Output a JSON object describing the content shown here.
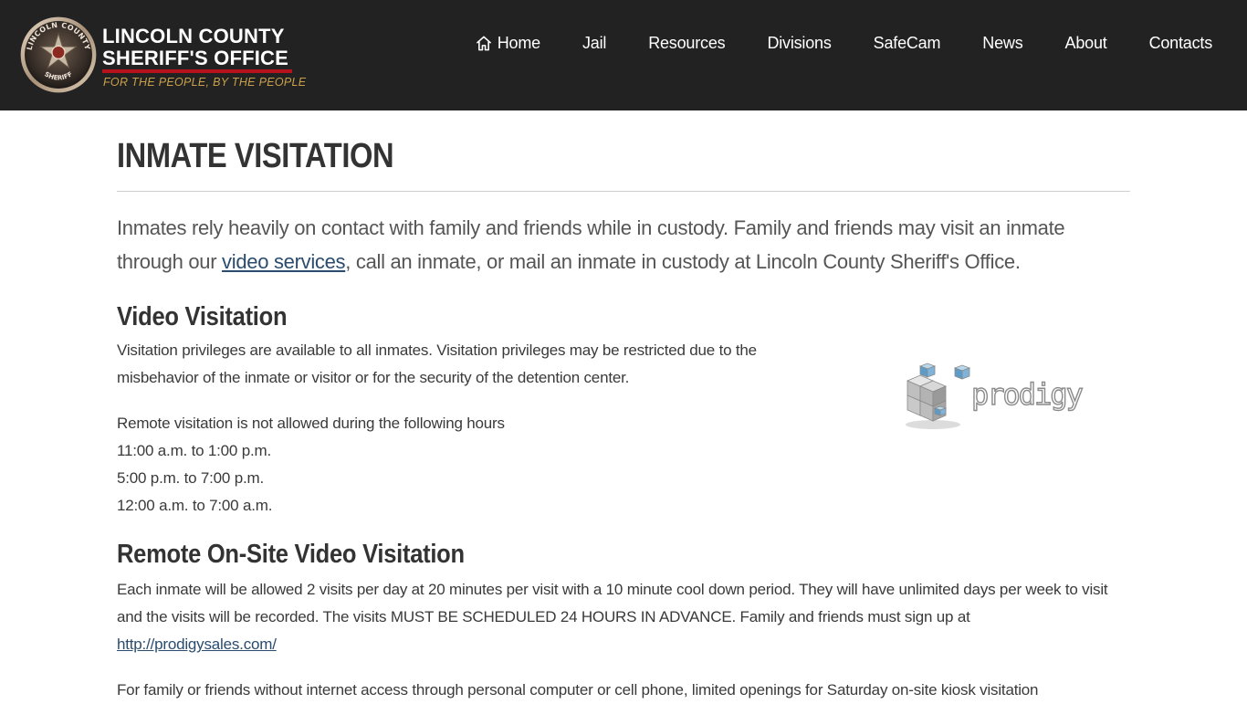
{
  "header": {
    "logo": {
      "line1": "LINCOLN COUNTY",
      "line2": "SHERIFF'S OFFICE",
      "tagline": "FOR THE PEOPLE, BY THE PEOPLE",
      "badge_top_text": "LINCOLN COUNTY",
      "badge_bottom_text": "SHERIFF"
    },
    "nav": [
      {
        "label": "Home",
        "icon": "home-icon"
      },
      {
        "label": "Jail"
      },
      {
        "label": "Resources"
      },
      {
        "label": "Divisions"
      },
      {
        "label": "SafeCam"
      },
      {
        "label": "News"
      },
      {
        "label": "About"
      },
      {
        "label": "Contacts"
      }
    ]
  },
  "page": {
    "title": "INMATE VISITATION",
    "intro": {
      "before_link": "Inmates rely heavily on contact with family and friends while in custody. Family and friends may visit an inmate through our ",
      "link": "video services",
      "after_link": ", call an inmate, or mail an inmate in custody at Lincoln County Sheriff's Office."
    },
    "video_visitation": {
      "heading": "Video Visitation",
      "paragraph": "Visitation privileges are available to all inmates. Visitation privileges may be restricted due to the misbehavior of the inmate or visitor or for the security of the detention center.",
      "hours_intro": "Remote visitation is not allowed during the following hours",
      "hours": [
        "11:00 a.m. to 1:00 p.m.",
        "5:00 p.m. to 7:00 p.m.",
        "12:00 a.m. to 7:00 a.m."
      ],
      "partner_logo_text": "prodigy"
    },
    "remote_onsite": {
      "heading": "Remote On-Site Video Visitation",
      "paragraph": "Each inmate will be allowed 2 visits per day at 20 minutes per visit with a 10 minute cool down period. They will have unlimited days per week to visit and the visits will be recorded. The visits MUST BE SCHEDULED 24 HOURS IN ADVANCE. Family and friends must sign up at",
      "link": "http://prodigysales.com/",
      "next_paragraph": "For family or friends without internet access through personal computer or cell phone, limited openings for Saturday on-site kiosk visitation"
    }
  },
  "colors": {
    "header_bg": "#222222",
    "logo_red": "#b5121b",
    "tagline_gold": "#c8a04a",
    "link": "#2b4c6e"
  }
}
